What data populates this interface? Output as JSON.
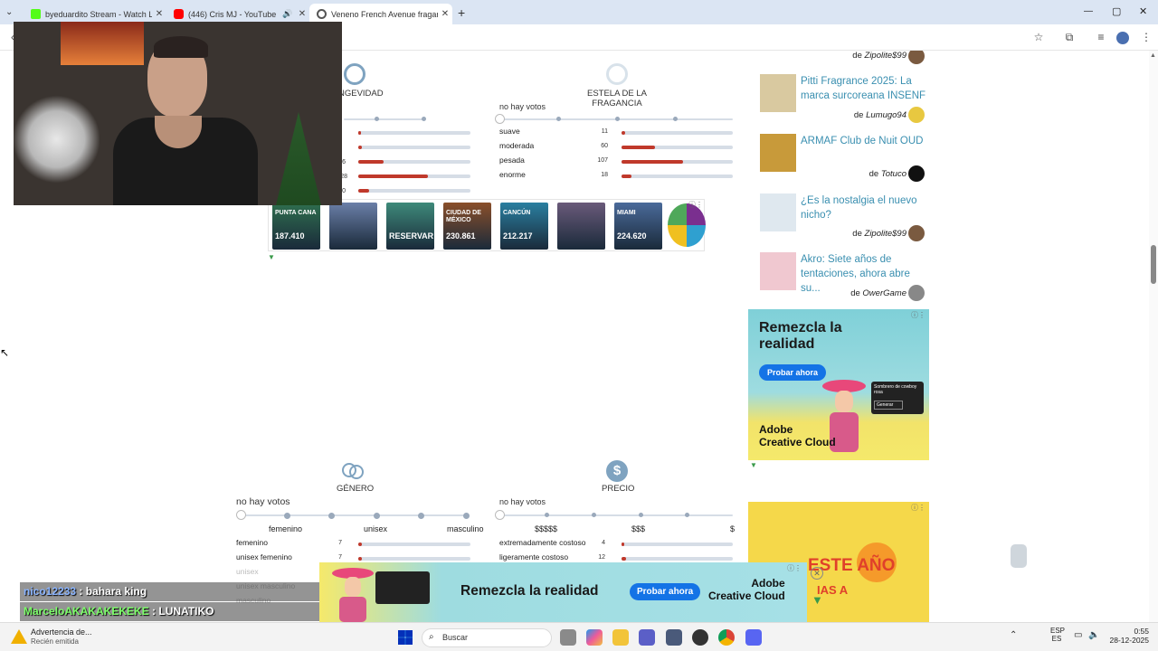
{
  "browser": {
    "tabs": [
      {
        "title": "byeduardito Stream - Watch Li",
        "favicon_color": "#53fc18"
      },
      {
        "title": "(446) Cris MJ - YouTube",
        "favicon_color": "#ff0000"
      },
      {
        "title": "Veneno French Avenue fragance",
        "favicon_color": "#555555"
      }
    ],
    "new_tab_symbol": "+"
  },
  "sections": {
    "longevity": {
      "title": "NGEVIDAD",
      "counts": [
        "6",
        "28",
        "0"
      ]
    },
    "sillage": {
      "title": "ESTELA DE LA FRAGANCIA",
      "no_votes": "no hay votos",
      "rows": [
        {
          "label": "suave",
          "count": "11",
          "fraction": 0.03
        },
        {
          "label": "moderada",
          "count": "60",
          "fraction": 0.3
        },
        {
          "label": "pesada",
          "count": "107",
          "fraction": 0.55
        },
        {
          "label": "enorme",
          "count": "18",
          "fraction": 0.09
        }
      ]
    },
    "gender": {
      "title": "GÉNERO",
      "no_votes": "no hay votos",
      "scale": [
        "femenino",
        "unisex",
        "masculino"
      ],
      "rows": [
        {
          "label": "femenino",
          "count": "7",
          "fraction": 0.03
        },
        {
          "label": "unisex femenino",
          "count": "7",
          "fraction": 0.03
        },
        {
          "label": "unisex",
          "count": "",
          "fraction": 0
        },
        {
          "label": "unisex masculino",
          "count": "",
          "fraction": 0
        },
        {
          "label": "masculino",
          "count": "",
          "fraction": 0
        }
      ]
    },
    "price": {
      "title": "PRECIO",
      "no_votes": "no hay votos",
      "scale": [
        "$$$$$",
        "$$$",
        "$"
      ],
      "rows": [
        {
          "label": "extremadamente costoso",
          "count": "4",
          "fraction": 0.01
        },
        {
          "label": "ligeramente costoso",
          "count": "12",
          "fraction": 0.04
        }
      ]
    }
  },
  "travel_ad": {
    "cards": [
      {
        "city": "PUNTA CANA",
        "price": "187.410",
        "color": "#2f6f4f"
      },
      {
        "city": "",
        "price": "",
        "color": "#6b7fa8"
      },
      {
        "city": "",
        "price": "RESERVAR",
        "color": "#3e8a7a"
      },
      {
        "city": "CIUDAD DE MÉXICO",
        "price": "230.861",
        "color": "#8a4f2a"
      },
      {
        "city": "CANCÚN",
        "price": "212.217",
        "color": "#2a7fa0"
      },
      {
        "city": "",
        "price": "",
        "color": "#6a5a7a"
      },
      {
        "city": "MIAMI",
        "price": "224.620",
        "color": "#4a6a9a"
      }
    ]
  },
  "sidebar": {
    "articles": [
      {
        "title": "",
        "by": "de",
        "author": "Zipolite$99",
        "avatar": "#7a5a40",
        "thumb": ""
      },
      {
        "title": "Pitti Fragrance 2025: La marca surcoreana INSENF",
        "by": "de",
        "author": "Lumugo94",
        "avatar": "#e8c840",
        "thumb": "#d9c9a0"
      },
      {
        "title": "ARMAF Club de Nuit OUD",
        "by": "de",
        "author": "Totuco",
        "avatar": "#111111",
        "thumb": "#c89a3a"
      },
      {
        "title": "¿Es la nostalgia el nuevo nicho?",
        "by": "de",
        "author": "Zipolite$99",
        "avatar": "#7a5a40",
        "thumb": "#dfe8ef"
      },
      {
        "title": "Akro: Siete años de tentaciones, ahora abre su...",
        "by": "de",
        "author": "OwerGame",
        "avatar": "#888888",
        "thumb": "#f0c8d0"
      }
    ]
  },
  "adobe_ad": {
    "headline": "Remezcla la realidad",
    "cta": "Probar ahora",
    "brand_line1": "Adobe",
    "brand_line2": "Creative Cloud",
    "popup_text": "Sombrero de cowboy rosa",
    "popup_btn": "Generar"
  },
  "bottom_ad": {
    "headline": "Remezcla la realidad",
    "cta": "Probar ahora",
    "brand_line1": "Adobe",
    "brand_line2": "Creative Cloud"
  },
  "yellow_ad": {
    "text": "ESTE AÑO",
    "sub": "IAS A"
  },
  "chat": [
    {
      "user": "nico12233",
      "msg": "bahara king",
      "color": "#8ab4ff"
    },
    {
      "user": "MarceloAKAKAKEKEKE",
      "msg": "LUNATIKO",
      "color": "#7dff6a"
    }
  ],
  "taskbar": {
    "notification_title": "Advertencia de...",
    "notification_sub": "Recién emitida",
    "search_placeholder": "Buscar",
    "lang_top": "ESP",
    "lang_bottom": "ES",
    "time": "0:55",
    "date": "28-12-2025"
  }
}
